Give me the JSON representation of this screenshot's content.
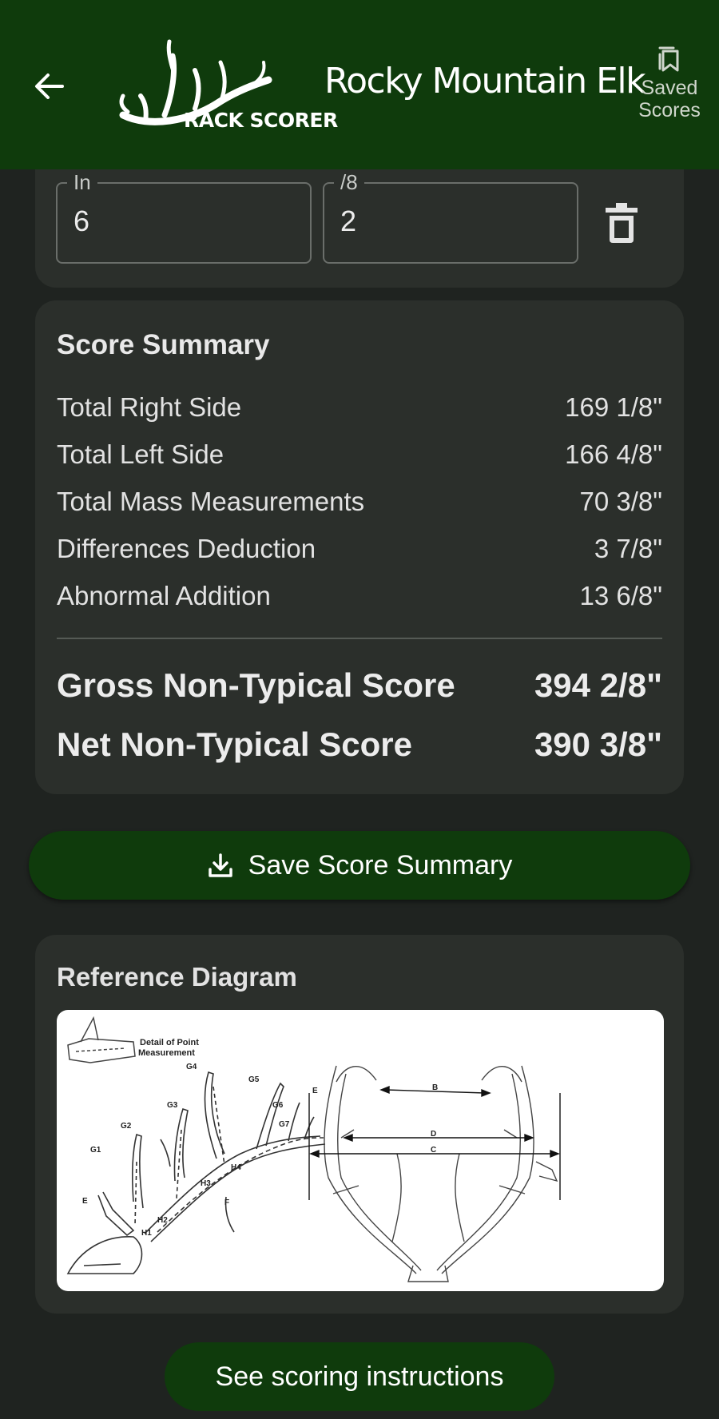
{
  "app_bar": {
    "title": "Rocky Mountain Elk",
    "logo_text": "RACK SCORER",
    "saved_label_line1": "Saved",
    "saved_label_line2": "Scores",
    "color": "#0f3b0c"
  },
  "measurement_row": {
    "inches_label": "In",
    "inches_value": "6",
    "eighths_label": "/8",
    "eighths_value": "2"
  },
  "score_summary": {
    "title": "Score Summary",
    "rows": [
      {
        "label": "Total Right Side",
        "value": "169 1/8\""
      },
      {
        "label": "Total Left Side",
        "value": "166 4/8\""
      },
      {
        "label": "Total Mass Measurements",
        "value": "70 3/8\""
      },
      {
        "label": "Differences Deduction",
        "value": "3 7/8\""
      },
      {
        "label": "Abnormal Addition",
        "value": "13 6/8\""
      }
    ],
    "gross_label": "Gross Non-Typical Score",
    "gross_value": "394 2/8\"",
    "net_label": "Net Non-Typical Score",
    "net_value": "390 3/8\""
  },
  "save_button": {
    "label": "Save Score Summary",
    "icon": "download-icon"
  },
  "reference_diagram": {
    "title": "Reference Diagram",
    "detail_caption_line1": "Detail of Point",
    "detail_caption_line2": "Measurement",
    "side_labels": [
      "G1",
      "G2",
      "G3",
      "G4",
      "G5",
      "G6",
      "G7",
      "H1",
      "H2",
      "H3",
      "H4",
      "E",
      "F"
    ],
    "front_labels": [
      "B",
      "C",
      "D",
      "E"
    ]
  },
  "instructions_button": {
    "label": "See scoring instructions"
  }
}
